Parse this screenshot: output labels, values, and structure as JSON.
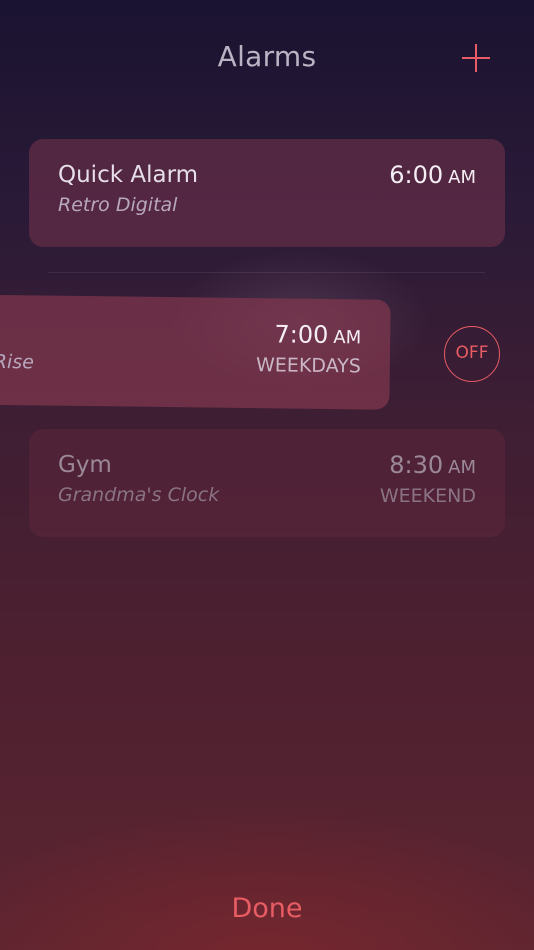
{
  "header": {
    "title": "Alarms",
    "add_icon": "plus-icon"
  },
  "alarms": [
    {
      "name": "Quick Alarm",
      "sound": "Retro Digital",
      "time": "6:00",
      "period": "AM",
      "repeat": ""
    },
    {
      "name": "",
      "sound": "Rise",
      "time": "7:00",
      "period": "AM",
      "repeat": "WEEKDAYS",
      "toggle_label": "OFF"
    },
    {
      "name": "Gym",
      "sound": "Grandma's Clock",
      "time": "8:30",
      "period": "AM",
      "repeat": "WEEKEND"
    }
  ],
  "footer": {
    "done_label": "Done"
  },
  "colors": {
    "accent": "#e85c63"
  }
}
